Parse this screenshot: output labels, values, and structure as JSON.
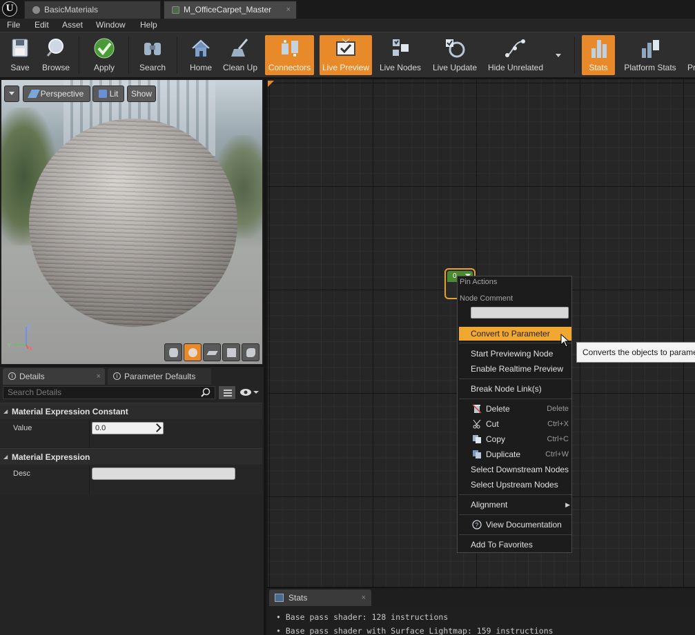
{
  "tabs": [
    {
      "label": "BasicMaterials"
    },
    {
      "label": "M_OfficeCarpet_Master"
    }
  ],
  "tab_close_glyph": "×",
  "menu": [
    "File",
    "Edit",
    "Asset",
    "Window",
    "Help"
  ],
  "toolbar": {
    "items": [
      {
        "label": "Save",
        "icon": "floppy-disk-icon",
        "active": false
      },
      {
        "label": "Browse",
        "icon": "magnifier-icon",
        "active": false
      },
      {
        "label": "Apply",
        "icon": "checkmark-icon",
        "active": false
      },
      {
        "label": "Search",
        "icon": "binoculars-icon",
        "active": false
      },
      {
        "label": "Home",
        "icon": "house-icon",
        "active": false
      },
      {
        "label": "Clean Up",
        "icon": "broom-icon",
        "active": false
      },
      {
        "label": "Connectors",
        "icon": "connectors-icon",
        "active": true
      },
      {
        "label": "Live Preview",
        "icon": "tv-icon",
        "active": true
      },
      {
        "label": "Live Nodes",
        "icon": "live-nodes-icon",
        "active": false
      },
      {
        "label": "Live Update",
        "icon": "live-update-icon",
        "active": false
      },
      {
        "label": "Hide Unrelated",
        "icon": "hide-unrelated-icon",
        "active": false
      },
      {
        "label": "Stats",
        "icon": "stats-icon",
        "active": true
      },
      {
        "label": "Platform Stats",
        "icon": "platform-stats-icon",
        "active": false
      },
      {
        "label": "Pr",
        "icon": "",
        "active": false
      }
    ]
  },
  "viewport": {
    "perspective_label": "Perspective",
    "lit_label": "Lit",
    "show_label": "Show",
    "axis_x": "X",
    "axis_y": "Y",
    "axis_z": "Z",
    "preview_shapes": [
      "cylinder-icon",
      "sphere-icon",
      "plane-icon",
      "cube-icon",
      "custom-mesh-icon"
    ],
    "active_shape": "sphere-icon"
  },
  "details": {
    "tab_label": "Details",
    "param_tab_label": "Parameter Defaults",
    "search_placeholder": "Search Details",
    "categories": [
      {
        "title": "Material Expression Constant",
        "property": "Value",
        "value": "0.0"
      },
      {
        "title": "Material Expression",
        "property": "Desc",
        "value": ""
      }
    ]
  },
  "graph": {
    "node_value": "0"
  },
  "context_menu": {
    "header_pin_actions": "Pin Actions",
    "header_node_comment": "Node Comment",
    "comment_value": "",
    "items": [
      {
        "label": "Convert to Parameter",
        "highlighted": true,
        "shortcut": "",
        "icon": ""
      },
      {
        "label": "Start Previewing Node",
        "shortcut": "",
        "icon": ""
      },
      {
        "label": "Enable Realtime Preview",
        "shortcut": "",
        "icon": ""
      },
      {
        "label": "Break Node Link(s)",
        "shortcut": "",
        "icon": ""
      },
      {
        "label": "Delete",
        "shortcut": "Delete",
        "icon": "delete-icon"
      },
      {
        "label": "Cut",
        "shortcut": "Ctrl+X",
        "icon": "scissors-icon"
      },
      {
        "label": "Copy",
        "shortcut": "Ctrl+C",
        "icon": "copy-icon"
      },
      {
        "label": "Duplicate",
        "shortcut": "Ctrl+W",
        "icon": "duplicate-icon"
      },
      {
        "label": "Select Downstream Nodes",
        "shortcut": "",
        "icon": ""
      },
      {
        "label": "Select Upstream Nodes",
        "shortcut": "",
        "icon": ""
      },
      {
        "label": "Alignment",
        "shortcut": "",
        "icon": "",
        "submenu": true
      },
      {
        "label": "View Documentation",
        "shortcut": "",
        "icon": "help-icon"
      },
      {
        "label": "Add To Favorites",
        "shortcut": "",
        "icon": ""
      }
    ],
    "tooltip": "Converts the objects to parameters"
  },
  "stats": {
    "tab_label": "Stats",
    "lines": [
      "• Base pass shader: 128 instructions",
      "• Base pass shader with Surface Lightmap: 159 instructions"
    ]
  },
  "colors": {
    "accent_orange": "#e88a2a",
    "menu_highlight": "#f0a830",
    "node_green": "#4c8a32"
  }
}
